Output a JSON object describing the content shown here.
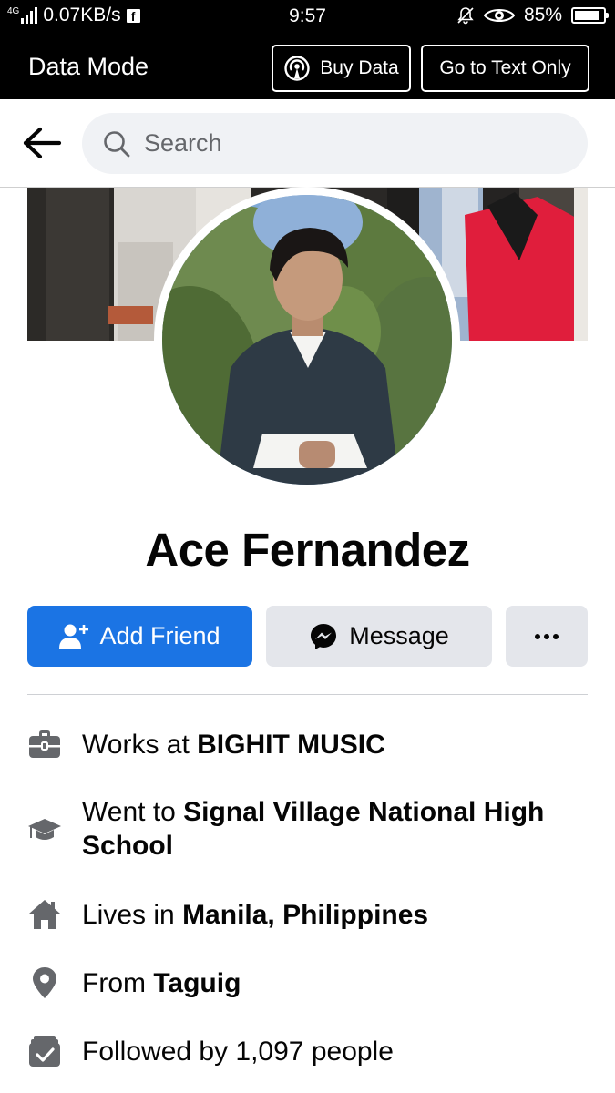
{
  "status_bar": {
    "network": "4G",
    "speed": "0.07KB/s",
    "app_badge": "f",
    "time": "9:57",
    "battery": "85%",
    "battery_level": 0.85
  },
  "data_bar": {
    "title": "Data Mode",
    "buy_data_label": "Buy Data",
    "text_only_label": "Go to Text Only"
  },
  "search": {
    "placeholder": "Search"
  },
  "profile": {
    "name": "Ace Fernandez"
  },
  "actions": {
    "add_friend_label": "Add Friend",
    "message_label": "Message",
    "more_label": "···"
  },
  "intro": {
    "work_prefix": "Works at ",
    "work_value": "BIGHIT MUSIC",
    "school_prefix": "Went to ",
    "school_value": "Signal Village National High School",
    "lives_prefix": "Lives in ",
    "lives_value": "Manila, Philippines",
    "from_prefix": "From ",
    "from_value": "Taguig",
    "followers_text": "Followed by 1,097 people"
  },
  "icons": {
    "back": "arrow-left-icon",
    "search": "search-icon",
    "buy_data": "antenna-icon",
    "add_friend": "add-person-icon",
    "message": "messenger-icon",
    "work": "briefcase-icon",
    "school": "graduation-cap-icon",
    "lives": "home-icon",
    "from": "location-pin-icon",
    "followers": "followers-icon"
  },
  "colors": {
    "primary_blue": "#1b74e4",
    "secondary_button": "#e4e6eb",
    "icon_gray": "#65676b",
    "bar_black": "#000000"
  }
}
